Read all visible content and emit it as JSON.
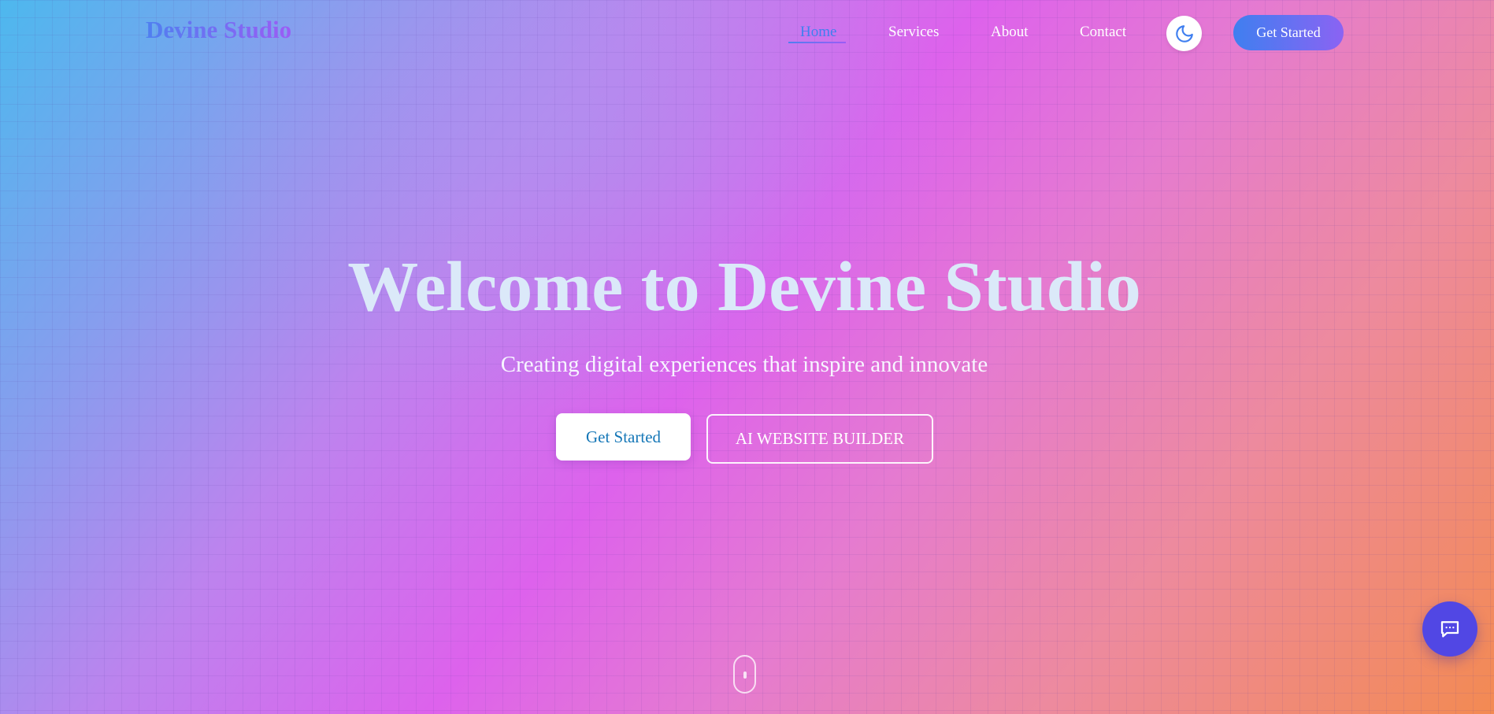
{
  "brand": {
    "name": "Devine Studio"
  },
  "nav": {
    "links": [
      {
        "label": "Home",
        "active": true
      },
      {
        "label": "Services",
        "active": false
      },
      {
        "label": "About",
        "active": false
      },
      {
        "label": "Contact",
        "active": false
      }
    ],
    "theme_toggle_icon": "moon-icon",
    "cta_label": "Get Started"
  },
  "hero": {
    "title": "Welcome to Devine Studio",
    "subtitle": "Creating digital experiences that inspire and innovate",
    "primary_button": "Get Started",
    "secondary_button": "AI WEBSITE BUILDER"
  },
  "scroll_indicator_icon": "mouse-scroll-icon",
  "chat_button_icon": "chat-icon",
  "colors": {
    "accent": "#3f7ff0",
    "accent_secondary": "#9b5cf5",
    "chat_button": "#5147e4",
    "primary_button_text": "#1577b7"
  }
}
